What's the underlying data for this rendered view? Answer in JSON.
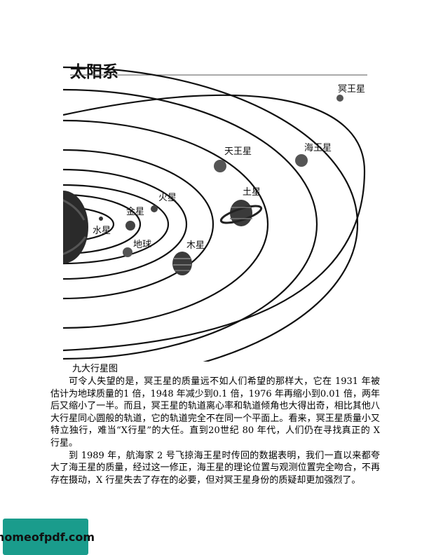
{
  "figure": {
    "title": "太阳系",
    "labels": {
      "mercury": "水星",
      "venus": "金星",
      "earth": "地球",
      "mars": "火星",
      "jupiter": "木星",
      "saturn": "土星",
      "uranus": "天王星",
      "neptune": "海王星",
      "pluto": "冥王星"
    }
  },
  "caption": "九大行星图",
  "paragraphs": [
    "可令人失望的是，冥王星的质量远不如人们希望的那样大，它在 1931 年被估计为地球质量的1 倍，1948 年减少到0.1 倍，1976 年再缩小到0.01 倍，两年后又缩小了一半。而且，冥王星的轨道离心率和轨道倾角也大得出奇，相比其他八大行星同心圆般的轨道，它的轨道完全不在同一个平面上。看来，冥王星质量小又特立独行，难当“X行星”的大任。直到20世纪 80 年代，人们仍在寻找真正的 X 行星。",
    "到 1989 年，航海家 2 号飞掠海王星时传回的数据表明，我们一直以来都夸大了海王星的质量，经过这一修正，海王星的理论位置与观测位置完全吻合，不再存在摄动，X 行星失去了存在的必要，但对冥王星身份的质疑却更加强烈了。"
  ],
  "watermark": "homeofpdf.com",
  "colors": {
    "watermark_bg": "#1a9c8c",
    "ink": "#111111"
  }
}
